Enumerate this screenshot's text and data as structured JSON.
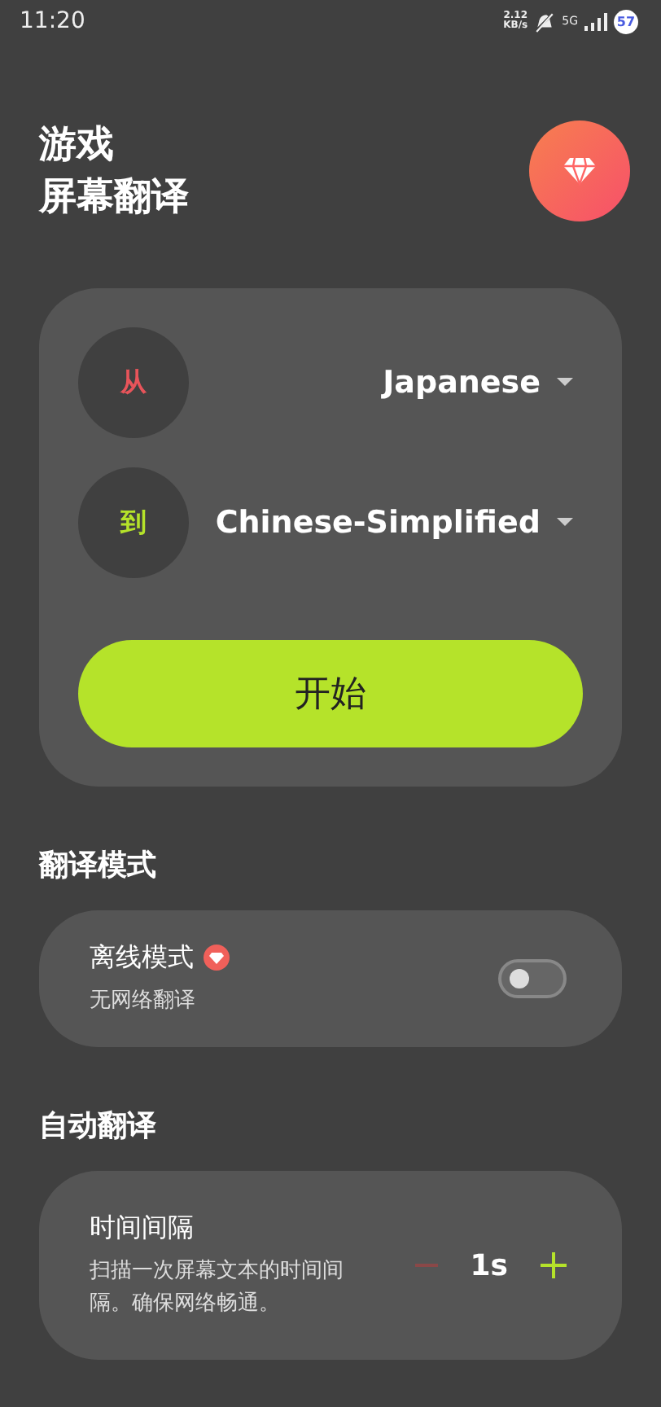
{
  "status_bar": {
    "time": "11:20",
    "speed": "2.12",
    "speed_unit": "KB/s",
    "network": "5G",
    "battery": "57"
  },
  "header": {
    "title_lines": [
      "游戏",
      "屏幕翻译"
    ]
  },
  "languages": [
    {
      "label": "从",
      "value": "Japanese",
      "color": "#e8545a"
    },
    {
      "label": "到",
      "value": "Chinese-Simplified",
      "color": "#b5e32a"
    }
  ],
  "start_button": "开始",
  "sections": [
    {
      "title": "翻译模式",
      "kind": "toggle",
      "name": "离线模式",
      "premium": true,
      "description": "无网络翻译",
      "on": false
    },
    {
      "title": "自动翻译",
      "kind": "stepper",
      "name": "时间间隔",
      "premium": false,
      "description": "扫描一次屏幕文本的时间间隔。确保网络畅通。",
      "value": "1s",
      "decrease_disabled": true
    }
  ]
}
